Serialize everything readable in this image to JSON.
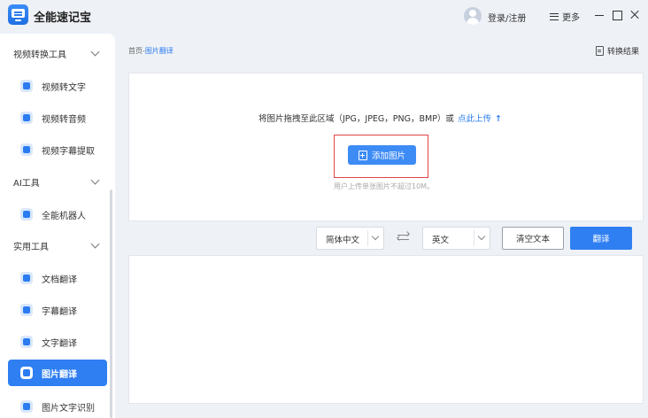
{
  "app": {
    "title": "全能速记宝"
  },
  "titlebar": {
    "login": "登录/注册",
    "more": "更多"
  },
  "sidebar": {
    "groups": [
      {
        "label": "视频转换工具",
        "items": [
          "视频转文字",
          "视频转音频",
          "视频字幕提取"
        ]
      },
      {
        "label": "AI工具",
        "items": [
          "全能机器人"
        ]
      },
      {
        "label": "实用工具",
        "items": [
          "文档翻译",
          "字幕翻译",
          "文字翻译",
          "图片翻译",
          "图片文字识别"
        ]
      }
    ],
    "active_item": "图片翻译"
  },
  "breadcrumb": {
    "home": "首页",
    "separator": "-",
    "current": "图片翻译"
  },
  "header": {
    "convert_result": "转换结果"
  },
  "upload": {
    "hint": "将图片拖拽至此区域（JPG，JPEG，PNG，BMP）或",
    "link": "点此上传",
    "button": "添加图片",
    "limit": "用户上传单张图片不超过10M。"
  },
  "controls": {
    "source_lang": "简体中文",
    "target_lang": "英文",
    "clear": "清空文本",
    "translate": "翻译"
  },
  "colors": {
    "accent": "#2f7ff2",
    "highlight": "#e04545"
  }
}
